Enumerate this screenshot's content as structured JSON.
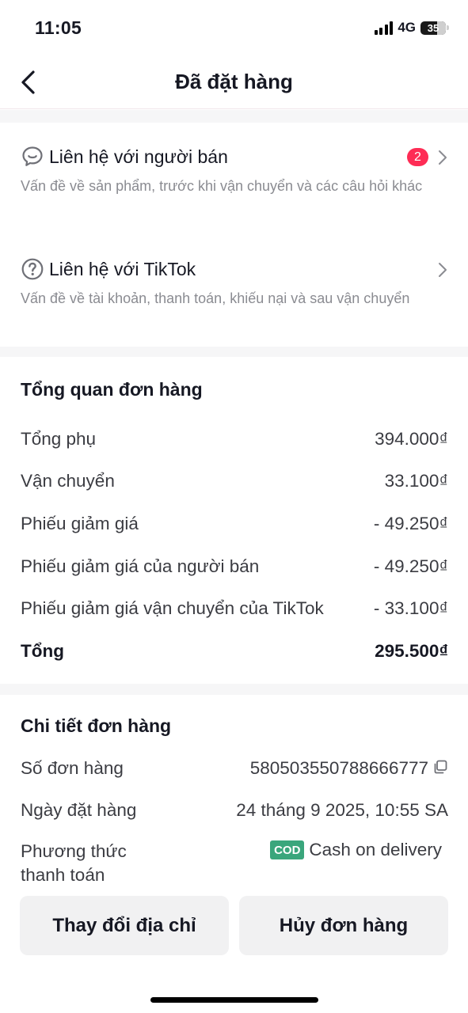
{
  "status_bar": {
    "time": "11:05",
    "network": "4G",
    "battery": "35"
  },
  "nav": {
    "title": "Đã đặt hàng"
  },
  "contacts": [
    {
      "title": "Liên hệ với người bán",
      "description": "Vấn đề về sản phẩm, trước khi vận chuyển và các câu hỏi khác",
      "badge": "2",
      "icon": "chat-bubble-icon"
    },
    {
      "title": "Liên hệ với TikTok",
      "description": "Vấn đề về tài khoản, thanh toán, khiếu nại và sau vận chuyển",
      "icon": "help-circle-icon"
    }
  ],
  "overview": {
    "title": "Tổng quan đơn hàng",
    "rows": [
      {
        "label": "Tổng phụ",
        "value": "394.000₫"
      },
      {
        "label": "Vận chuyển",
        "value": "33.100₫"
      },
      {
        "label": "Phiếu giảm giá",
        "value": "- 49.250₫"
      },
      {
        "label": "Phiếu giảm giá của người bán",
        "value": "- 49.250₫"
      },
      {
        "label": "Phiếu giảm giá vận chuyển của TikTok",
        "value": "- 33.100₫"
      }
    ],
    "total": {
      "label": "Tổng",
      "value": "295.500₫"
    }
  },
  "details": {
    "title": "Chi tiết đơn hàng",
    "order_number": {
      "label": "Số đơn hàng",
      "value": "580503550788666777"
    },
    "order_date": {
      "label": "Ngày đặt hàng",
      "value": "24 tháng 9 2025, 10:55 SA"
    },
    "payment": {
      "label": "Phương thức thanh toán",
      "badge": "COD",
      "value": "Cash on delivery"
    }
  },
  "actions": {
    "change_address": "Thay đổi địa chỉ",
    "cancel_order": "Hủy đơn hàng"
  },
  "colors": {
    "accent": "#fe2c55",
    "cod": "#3aa67c",
    "band": "#f6f6f7",
    "button": "#f1f1f2"
  }
}
